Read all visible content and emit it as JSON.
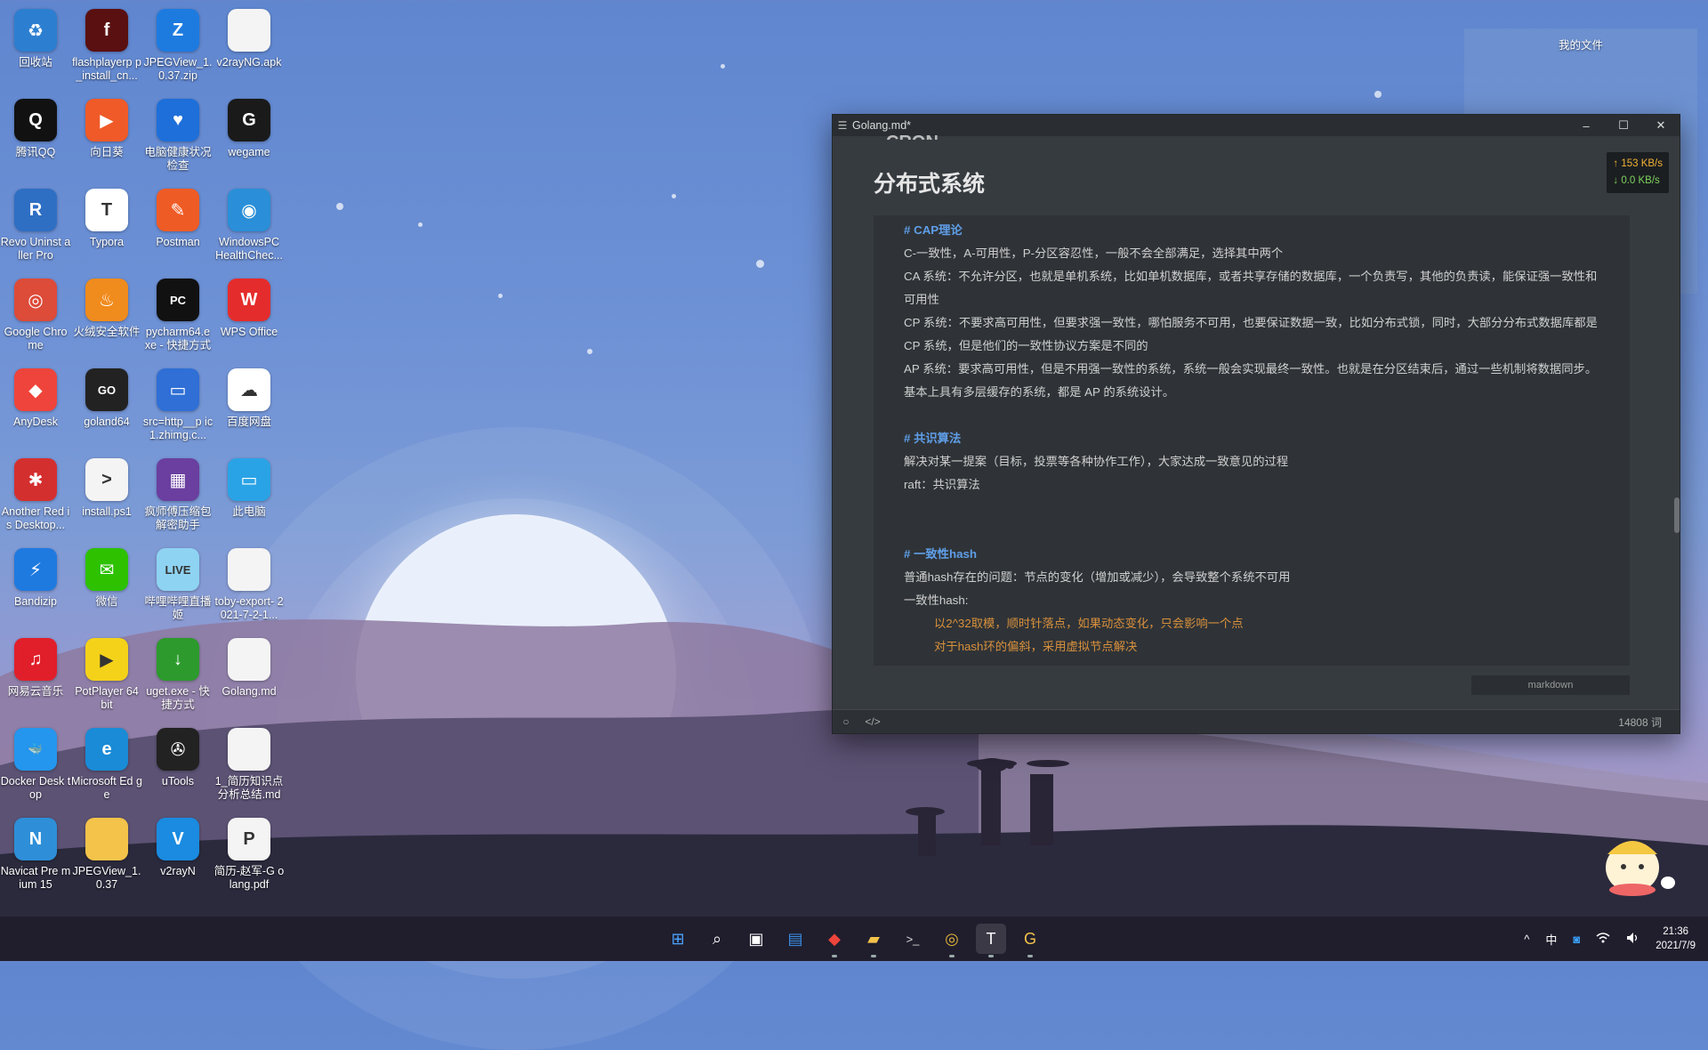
{
  "desktop": {
    "icons": [
      {
        "label": "回收站",
        "icon": "recycle-bin-icon",
        "color": "#2c7fd0",
        "glyph": "♻"
      },
      {
        "label": "flashplayerp p_install_cn...",
        "icon": "flash-icon",
        "color": "#5a1010",
        "glyph": "f"
      },
      {
        "label": "JPEGView_1. 0.37.zip",
        "icon": "zip-icon",
        "color": "#1d7be0",
        "glyph": "Z"
      },
      {
        "label": "v2rayNG.apk",
        "icon": "file-icon",
        "color": "#f4f4f4",
        "glyph": ""
      },
      {
        "label": "腾讯QQ",
        "icon": "qq-icon",
        "color": "#111111",
        "glyph": "Q"
      },
      {
        "label": "向日葵",
        "icon": "sunlogin-icon",
        "color": "#f05a28",
        "glyph": "▶"
      },
      {
        "label": "电脑健康状况 检查",
        "icon": "health-check-icon",
        "color": "#1e6fd9",
        "glyph": "♥"
      },
      {
        "label": "wegame",
        "icon": "wegame-icon",
        "color": "#1a1a1a",
        "glyph": "G"
      },
      {
        "label": "Revo Uninst aller Pro",
        "icon": "revo-uninstaller-icon",
        "color": "#2e6fc4",
        "glyph": "R"
      },
      {
        "label": "Typora",
        "icon": "typora-icon",
        "color": "#ffffff",
        "glyph": "T"
      },
      {
        "label": "Postman",
        "icon": "postman-icon",
        "color": "#ef5b25",
        "glyph": "✎"
      },
      {
        "label": "WindowsPC HealthChec...",
        "icon": "pc-health-icon",
        "color": "#2a8fd8",
        "glyph": "◉"
      },
      {
        "label": "Google Chro me",
        "icon": "chrome-icon",
        "color": "#dd4b39",
        "glyph": "◎"
      },
      {
        "label": "火绒安全软件",
        "icon": "huorong-icon",
        "color": "#f08b1d",
        "glyph": "♨"
      },
      {
        "label": "pycharm64.e xe - 快捷方式",
        "icon": "pycharm-icon",
        "color": "#111111",
        "glyph": "PC"
      },
      {
        "label": "WPS Office",
        "icon": "wps-icon",
        "color": "#e52c2c",
        "glyph": "W"
      },
      {
        "label": "AnyDesk",
        "icon": "anydesk-icon",
        "color": "#ef443b",
        "glyph": "◆"
      },
      {
        "label": "goland64",
        "icon": "goland-icon",
        "color": "#222222",
        "glyph": "GO"
      },
      {
        "label": "src=http__p ic1.zhimg.c...",
        "icon": "image-file-icon",
        "color": "#2f6fd6",
        "glyph": "▭"
      },
      {
        "label": "百度网盘",
        "icon": "baidu-netdisk-icon",
        "color": "#ffffff",
        "glyph": "☁"
      },
      {
        "label": "Another Red is Desktop...",
        "icon": "redis-desktop-icon",
        "color": "#d42f2f",
        "glyph": "✱"
      },
      {
        "label": "install.ps1",
        "icon": "powershell-file-icon",
        "color": "#f4f4f4",
        "glyph": ">"
      },
      {
        "label": "疯师傅压缩包 解密助手",
        "icon": "archive-helper-icon",
        "color": "#6a3fa0",
        "glyph": "▦"
      },
      {
        "label": "此电脑",
        "icon": "this-pc-icon",
        "color": "#2aa3e6",
        "glyph": "▭"
      },
      {
        "label": "Bandizip",
        "icon": "bandizip-icon",
        "color": "#1f7ae0",
        "glyph": "⚡"
      },
      {
        "label": "微信",
        "icon": "wechat-icon",
        "color": "#2dc100",
        "glyph": "✉"
      },
      {
        "label": "哔哩哔哩直播 姬",
        "icon": "bilibili-live-icon",
        "color": "#8ed3f2",
        "glyph": "LIVE"
      },
      {
        "label": "toby-export- 2021-7-2-1...",
        "icon": "file-icon",
        "color": "#f4f4f4",
        "glyph": ""
      },
      {
        "label": "网易云音乐",
        "icon": "netease-music-icon",
        "color": "#e11f2a",
        "glyph": "♫"
      },
      {
        "label": "PotPlayer 64 bit",
        "icon": "potplayer-icon",
        "color": "#f4d21a",
        "glyph": "▶"
      },
      {
        "label": "uget.exe - 快 捷方式",
        "icon": "uget-icon",
        "color": "#2c9a2c",
        "glyph": "↓"
      },
      {
        "label": "Golang.md",
        "icon": "md-file-icon",
        "color": "#f4f4f4",
        "glyph": ""
      },
      {
        "label": "Docker Desk top",
        "icon": "docker-icon",
        "color": "#2496ed",
        "glyph": "🐳"
      },
      {
        "label": "Microsoft Ed ge",
        "icon": "edge-icon",
        "color": "#1a8bd6",
        "glyph": "e"
      },
      {
        "label": "uTools",
        "icon": "utools-icon",
        "color": "#222222",
        "glyph": "✇"
      },
      {
        "label": "1_简历知识点 分析总结.md",
        "icon": "md-file-icon",
        "color": "#f4f4f4",
        "glyph": ""
      },
      {
        "label": "Navicat Pre mium 15",
        "icon": "navicat-icon",
        "color": "#2e8fd8",
        "glyph": "N"
      },
      {
        "label": "JPEGView_1. 0.37",
        "icon": "folder-icon",
        "color": "#f3c34a",
        "glyph": ""
      },
      {
        "label": "v2rayN",
        "icon": "v2rayn-icon",
        "color": "#1a8be0",
        "glyph": "V"
      },
      {
        "label": "简历-赵军-G olang.pdf",
        "icon": "pdf-file-icon",
        "color": "#f4f4f4",
        "glyph": "P"
      }
    ]
  },
  "right_panel": {
    "label": "我的文件"
  },
  "window": {
    "title": "Golang.md*",
    "netspeed": {
      "up": "↑ 153 KB/s",
      "down": "↓ 0.0 KB/s"
    },
    "cut_heading": "CRON",
    "heading": "分布式系统",
    "code_lines": [
      {
        "type": "hd",
        "text": "# CAP理论"
      },
      {
        "type": "t",
        "text": "C-一致性，A-可用性，P-分区容忍性，一般不会全部满足，选择其中两个"
      },
      {
        "type": "w",
        "text": "CA 系统：不允许分区，也就是单机系统，比如单机数据库，或者共享存储的数据库，一个负责写，其他的负责读，能保证强一致性和可用性"
      },
      {
        "type": "w",
        "text": "CP 系统：不要求高可用性，但要求强一致性，哪怕服务不可用，也要保证数据一致，比如分布式锁，同时，大部分分布式数据库都是 CP 系统，但是他们的一致性协议方案是不同的"
      },
      {
        "type": "w",
        "text": "AP 系统：要求高可用性，但是不用强一致性的系统，系统一般会实现最终一致性。也就是在分区结束后，通过一些机制将数据同步。基本上具有多层缓存的系统，都是 AP 的系统设计。"
      },
      {
        "type": "gap",
        "text": ""
      },
      {
        "type": "hd",
        "text": "# 共识算法"
      },
      {
        "type": "t",
        "text": "解决对某一提案（目标，投票等各种协作工作），大家达成一致意见的过程"
      },
      {
        "type": "t",
        "text": "raft：共识算法"
      },
      {
        "type": "gap",
        "text": ""
      },
      {
        "type": "gap",
        "text": ""
      },
      {
        "type": "hd",
        "text": "# 一致性hash"
      },
      {
        "type": "t",
        "text": "普通hash存在的问题：节点的变化（增加或减少），会导致整个系统不可用"
      },
      {
        "type": "t",
        "text": "一致性hash:"
      },
      {
        "type": "or",
        "text": "以2^32取模，顺时针落点，如果动态变化，只会影响一个点"
      },
      {
        "type": "or",
        "text": "对于hash环的偏斜，采用虚拟节点解决"
      }
    ],
    "lang": "markdown",
    "word_count": "14808 词"
  },
  "taskbar": {
    "apps": [
      {
        "name": "start-button",
        "glyph": "⊞",
        "color": "#4aa3ff"
      },
      {
        "name": "search-button",
        "glyph": "⌕",
        "color": "#ffffff"
      },
      {
        "name": "task-view-button",
        "glyph": "▣",
        "color": "#ffffff"
      },
      {
        "name": "widgets-button",
        "glyph": "▤",
        "color": "#3a8ee6"
      },
      {
        "name": "anydesk-taskbar-button",
        "glyph": "◆",
        "color": "#ef443b"
      },
      {
        "name": "file-explorer-button",
        "glyph": "▰",
        "color": "#f3c34a"
      },
      {
        "name": "terminal-button",
        "glyph": ">_",
        "color": "#dddddd"
      },
      {
        "name": "chrome-taskbar-button",
        "glyph": "◎",
        "color": "#e5b53a"
      },
      {
        "name": "typora-taskbar-button",
        "glyph": "T",
        "color": "#ffffff"
      },
      {
        "name": "wegame-taskbar-button",
        "glyph": "G",
        "color": "#f3c34a"
      }
    ],
    "tray": {
      "chevron": "^",
      "ime": "中",
      "wifi": "wifi",
      "volume": "volume",
      "time": "21:36",
      "date": "2021/7/9"
    }
  }
}
